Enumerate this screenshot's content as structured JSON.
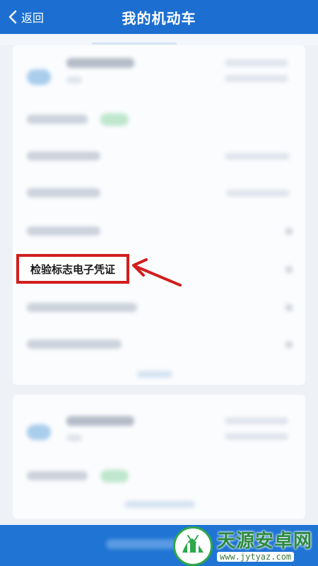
{
  "header": {
    "back_label": "返回",
    "title": "我的机动车",
    "bg_color": "#1c6fd0"
  },
  "highlighted_item": {
    "label": "检验标志电子凭证",
    "border_color": "#d11e1e",
    "arrow_color": "#d11e1e"
  },
  "watermark": {
    "name": "天源安卓网",
    "url": "www.jytyaz.com",
    "brand_color": "#2ea84a"
  },
  "icons": [
    "chevron-left-icon",
    "arrow-pointer-icon",
    "watermark-logo-icon"
  ]
}
